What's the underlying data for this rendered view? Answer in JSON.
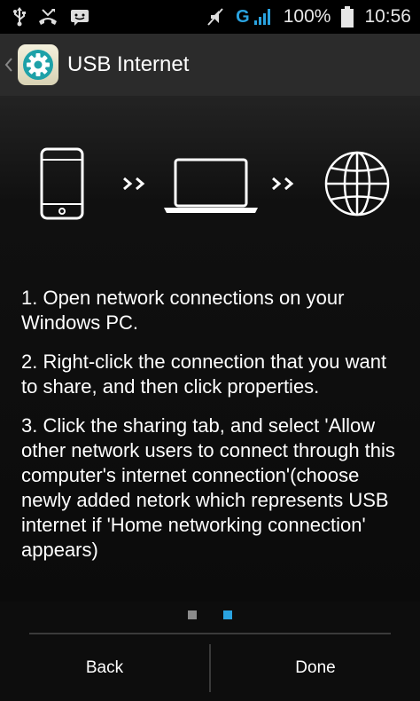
{
  "status_bar": {
    "network_type": "G",
    "battery": "100%",
    "time": "10:56",
    "icons": [
      "usb-icon",
      "missed-call-icon",
      "android-debug-icon",
      "mute-icon",
      "signal-icon",
      "battery-icon"
    ]
  },
  "action_bar": {
    "title": "USB Internet",
    "app_icon": "settings-gear-icon"
  },
  "illustration": {
    "icons": [
      "phone-icon",
      "arrows-icon",
      "laptop-icon",
      "arrows-icon",
      "globe-icon"
    ]
  },
  "instructions": {
    "steps": [
      "1. Open network connections on your Windows PC.",
      "2. Right-click the connection that you want to share, and then click properties.",
      "3. Click the sharing tab, and select 'Allow other network users to connect through this computer's internet connection'(choose newly added netork which represents USB internet if 'Home networking connection' appears)"
    ]
  },
  "pager": {
    "pages": 2,
    "current": 2
  },
  "buttons": {
    "back": "Back",
    "done": "Done"
  },
  "colors": {
    "accent": "#2aa3e0",
    "action_bar": "#2b2b2b",
    "background": "#0d0d0d"
  }
}
